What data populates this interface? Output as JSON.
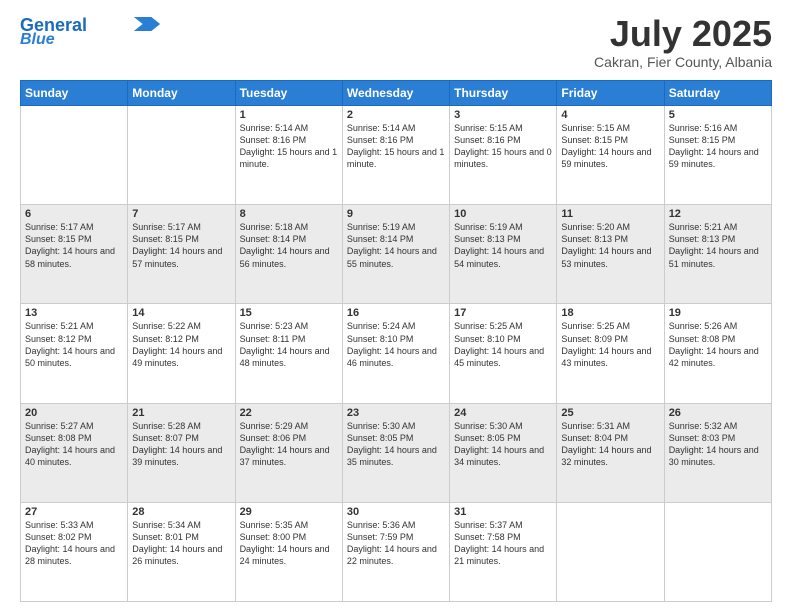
{
  "logo": {
    "line1": "General",
    "line2": "Blue"
  },
  "header": {
    "month": "July 2025",
    "location": "Cakran, Fier County, Albania"
  },
  "weekdays": [
    "Sunday",
    "Monday",
    "Tuesday",
    "Wednesday",
    "Thursday",
    "Friday",
    "Saturday"
  ],
  "weeks": [
    [
      null,
      null,
      {
        "day": 1,
        "sunrise": "5:14 AM",
        "sunset": "8:16 PM",
        "daylight": "15 hours and 1 minute."
      },
      {
        "day": 2,
        "sunrise": "5:14 AM",
        "sunset": "8:16 PM",
        "daylight": "15 hours and 1 minute."
      },
      {
        "day": 3,
        "sunrise": "5:15 AM",
        "sunset": "8:16 PM",
        "daylight": "15 hours and 0 minutes."
      },
      {
        "day": 4,
        "sunrise": "5:15 AM",
        "sunset": "8:15 PM",
        "daylight": "14 hours and 59 minutes."
      },
      {
        "day": 5,
        "sunrise": "5:16 AM",
        "sunset": "8:15 PM",
        "daylight": "14 hours and 59 minutes."
      }
    ],
    [
      {
        "day": 6,
        "sunrise": "5:17 AM",
        "sunset": "8:15 PM",
        "daylight": "14 hours and 58 minutes."
      },
      {
        "day": 7,
        "sunrise": "5:17 AM",
        "sunset": "8:15 PM",
        "daylight": "14 hours and 57 minutes."
      },
      {
        "day": 8,
        "sunrise": "5:18 AM",
        "sunset": "8:14 PM",
        "daylight": "14 hours and 56 minutes."
      },
      {
        "day": 9,
        "sunrise": "5:19 AM",
        "sunset": "8:14 PM",
        "daylight": "14 hours and 55 minutes."
      },
      {
        "day": 10,
        "sunrise": "5:19 AM",
        "sunset": "8:13 PM",
        "daylight": "14 hours and 54 minutes."
      },
      {
        "day": 11,
        "sunrise": "5:20 AM",
        "sunset": "8:13 PM",
        "daylight": "14 hours and 53 minutes."
      },
      {
        "day": 12,
        "sunrise": "5:21 AM",
        "sunset": "8:13 PM",
        "daylight": "14 hours and 51 minutes."
      }
    ],
    [
      {
        "day": 13,
        "sunrise": "5:21 AM",
        "sunset": "8:12 PM",
        "daylight": "14 hours and 50 minutes."
      },
      {
        "day": 14,
        "sunrise": "5:22 AM",
        "sunset": "8:12 PM",
        "daylight": "14 hours and 49 minutes."
      },
      {
        "day": 15,
        "sunrise": "5:23 AM",
        "sunset": "8:11 PM",
        "daylight": "14 hours and 48 minutes."
      },
      {
        "day": 16,
        "sunrise": "5:24 AM",
        "sunset": "8:10 PM",
        "daylight": "14 hours and 46 minutes."
      },
      {
        "day": 17,
        "sunrise": "5:25 AM",
        "sunset": "8:10 PM",
        "daylight": "14 hours and 45 minutes."
      },
      {
        "day": 18,
        "sunrise": "5:25 AM",
        "sunset": "8:09 PM",
        "daylight": "14 hours and 43 minutes."
      },
      {
        "day": 19,
        "sunrise": "5:26 AM",
        "sunset": "8:08 PM",
        "daylight": "14 hours and 42 minutes."
      }
    ],
    [
      {
        "day": 20,
        "sunrise": "5:27 AM",
        "sunset": "8:08 PM",
        "daylight": "14 hours and 40 minutes."
      },
      {
        "day": 21,
        "sunrise": "5:28 AM",
        "sunset": "8:07 PM",
        "daylight": "14 hours and 39 minutes."
      },
      {
        "day": 22,
        "sunrise": "5:29 AM",
        "sunset": "8:06 PM",
        "daylight": "14 hours and 37 minutes."
      },
      {
        "day": 23,
        "sunrise": "5:30 AM",
        "sunset": "8:05 PM",
        "daylight": "14 hours and 35 minutes."
      },
      {
        "day": 24,
        "sunrise": "5:30 AM",
        "sunset": "8:05 PM",
        "daylight": "14 hours and 34 minutes."
      },
      {
        "day": 25,
        "sunrise": "5:31 AM",
        "sunset": "8:04 PM",
        "daylight": "14 hours and 32 minutes."
      },
      {
        "day": 26,
        "sunrise": "5:32 AM",
        "sunset": "8:03 PM",
        "daylight": "14 hours and 30 minutes."
      }
    ],
    [
      {
        "day": 27,
        "sunrise": "5:33 AM",
        "sunset": "8:02 PM",
        "daylight": "14 hours and 28 minutes."
      },
      {
        "day": 28,
        "sunrise": "5:34 AM",
        "sunset": "8:01 PM",
        "daylight": "14 hours and 26 minutes."
      },
      {
        "day": 29,
        "sunrise": "5:35 AM",
        "sunset": "8:00 PM",
        "daylight": "14 hours and 24 minutes."
      },
      {
        "day": 30,
        "sunrise": "5:36 AM",
        "sunset": "7:59 PM",
        "daylight": "14 hours and 22 minutes."
      },
      {
        "day": 31,
        "sunrise": "5:37 AM",
        "sunset": "7:58 PM",
        "daylight": "14 hours and 21 minutes."
      },
      null,
      null
    ]
  ]
}
